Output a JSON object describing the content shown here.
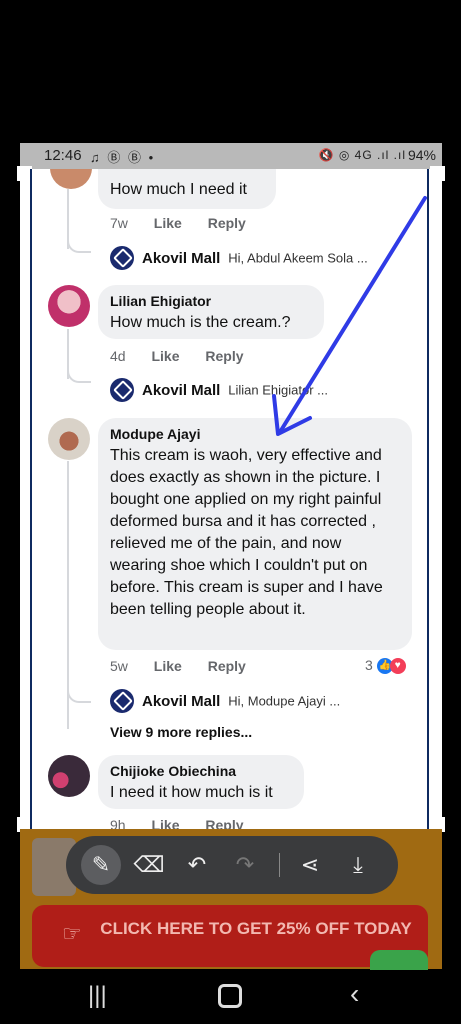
{
  "status_bar": {
    "time": "12:46",
    "left_icons": "♫ Ⓑ Ⓑ •",
    "right_icons": "🔇 ◎ 4G .ıl .ıl",
    "battery": "94%"
  },
  "comments": [
    {
      "text": "How much I need it",
      "time": "7w",
      "like_label": "Like",
      "reply_label": "Reply",
      "reply_preview": {
        "author": "Akovil Mall",
        "snippet": "Hi, Abdul Akeem Sola ..."
      }
    },
    {
      "author": "Lilian Ehigiator",
      "text": "How much is the cream.?",
      "time": "4d",
      "like_label": "Like",
      "reply_label": "Reply",
      "reply_preview": {
        "author": "Akovil Mall",
        "snippet": "Lilian Ehigiator ..."
      }
    },
    {
      "author": "Modupe Ajayi",
      "text": "This cream is waoh, very effective and does exactly as shown in the picture. I bought one applied on my right painful deformed bursa and it has corrected , relieved me of the pain, and now wearing shoe which I couldn't put on before. This cream is super and I have been telling people about it.",
      "time": "5w",
      "like_label": "Like",
      "reply_label": "Reply",
      "reaction_count": "3",
      "reply_preview": {
        "author": "Akovil Mall",
        "snippet": "Hi, Modupe Ajayi ..."
      },
      "more_replies": "View 9 more replies..."
    },
    {
      "author": "Chijioke Obiechina",
      "text": "I need it how much is it",
      "time": "9h",
      "like_label": "Like",
      "reply_label": "Reply"
    }
  ],
  "toolbar": {
    "tools": [
      "pen-icon",
      "eraser-icon",
      "undo-icon",
      "redo-icon",
      "share-icon",
      "save-icon"
    ]
  },
  "ad": {
    "cta": "CLICK HERE TO GET 25% OFF TODAY"
  },
  "colors": {
    "annotation_arrow": "#2f3be6",
    "cta_bg": "#b01e18",
    "ad_bg": "#a06a12"
  }
}
